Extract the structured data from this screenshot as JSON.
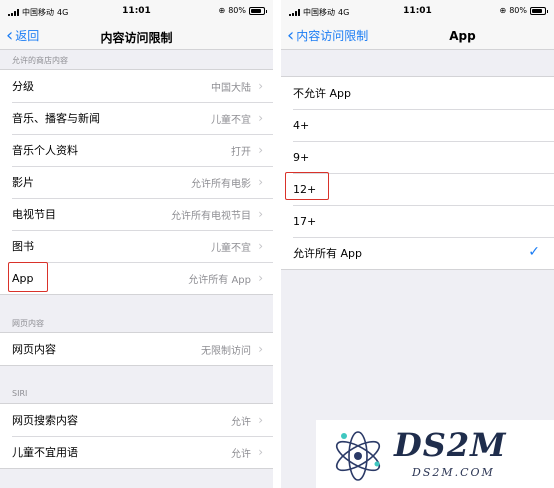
{
  "status_bar": {
    "carrier": "中国移动",
    "network": "4G",
    "time": "11:01",
    "battery": "80%",
    "battery_level": 0.8
  },
  "left_screen": {
    "nav": {
      "back_label": "返回",
      "title": "内容访问限制"
    },
    "sections": [
      {
        "header": "允许的商店内容",
        "rows": [
          {
            "label": "分级",
            "value": "中国大陆"
          },
          {
            "label": "音乐、播客与新闻",
            "value": "儿童不宜"
          },
          {
            "label": "音乐个人资料",
            "value": "打开"
          },
          {
            "label": "影片",
            "value": "允许所有电影"
          },
          {
            "label": "电视节目",
            "value": "允许所有电视节目"
          },
          {
            "label": "图书",
            "value": "儿童不宜"
          },
          {
            "label": "App",
            "value": "允许所有 App"
          }
        ]
      },
      {
        "header": "网页内容",
        "rows": [
          {
            "label": "网页内容",
            "value": "无限制访问"
          }
        ]
      },
      {
        "header": "SIRI",
        "rows": [
          {
            "label": "网页搜索内容",
            "value": "允许"
          },
          {
            "label": "儿童不宜用语",
            "value": "允许"
          }
        ]
      }
    ]
  },
  "right_screen": {
    "nav": {
      "back_label": "内容访问限制",
      "title": "App"
    },
    "options": [
      {
        "label": "不允许 App",
        "selected": false
      },
      {
        "label": "4+",
        "selected": false
      },
      {
        "label": "9+",
        "selected": false
      },
      {
        "label": "12+",
        "selected": false
      },
      {
        "label": "17+",
        "selected": false
      },
      {
        "label": "允许所有 App",
        "selected": true
      }
    ]
  },
  "watermark": {
    "brand": "DS2M",
    "url": "DS2M.COM"
  },
  "icons": {
    "back": "chevron-left-icon",
    "disclosure": "chevron-right-icon",
    "selected": "checkmark-icon",
    "lock": "rotation-lock-icon"
  },
  "colors": {
    "accent": "#1a7cf4",
    "highlight": "#d9322a",
    "background": "#efeff4",
    "secondary_text": "#8e8e93"
  }
}
